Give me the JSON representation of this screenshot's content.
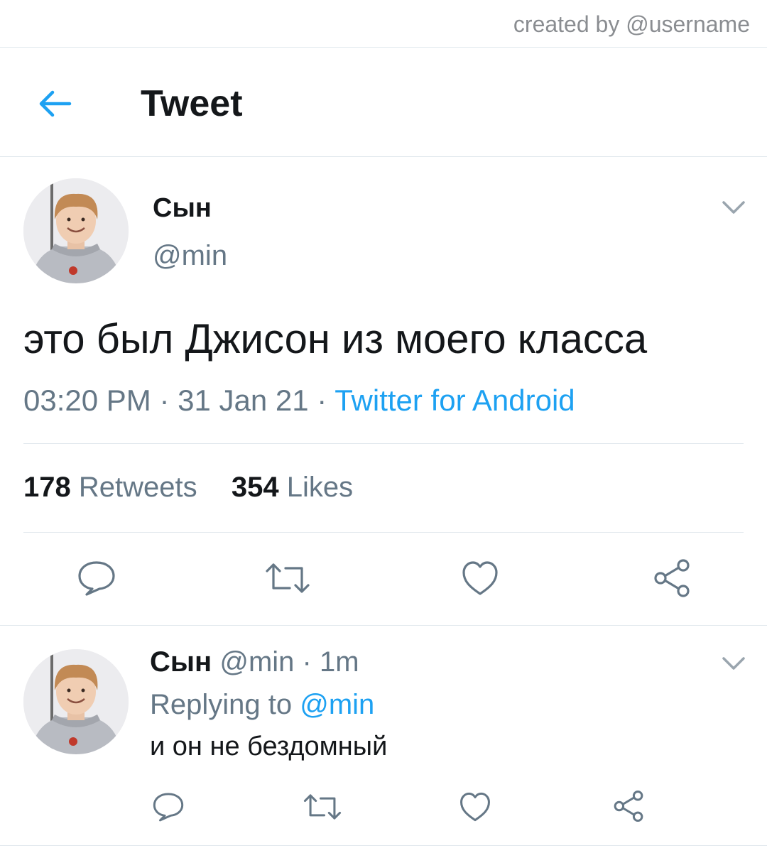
{
  "credit": "created by @username",
  "header": {
    "title": "Tweet"
  },
  "tweet": {
    "display_name": "Сын",
    "handle": "@min",
    "text": "это был Джисон из моего класса",
    "time": "03:20 PM",
    "sep1": " · ",
    "date": "31 Jan 21",
    "sep2": " · ",
    "source": "Twitter for Android",
    "retweets_count": "178",
    "retweets_label": "Retweets",
    "likes_count": "354",
    "likes_label": "Likes"
  },
  "reply": {
    "display_name": "Сын",
    "handle": "@min",
    "sep": " · ",
    "age": "1m",
    "replying_prefix": "Replying to ",
    "replying_to": "@min",
    "text": "и он не бездомный"
  },
  "icons": {
    "back": "arrow-left-icon",
    "menu": "chevron-down-icon",
    "reply": "speech-bubble-icon",
    "retweet": "retweet-icon",
    "like": "heart-icon",
    "share": "share-icon"
  },
  "colors": {
    "accent": "#1da1f2",
    "text": "#14171a",
    "muted": "#657786",
    "divider": "#e1e8ed"
  }
}
